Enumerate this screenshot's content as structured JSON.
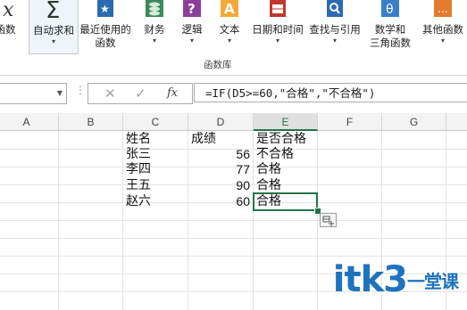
{
  "ribbon": {
    "buttons": [
      {
        "label": "函数",
        "icon": "insert-function-icon"
      },
      {
        "label": "自动求和",
        "icon": "sum-icon",
        "caret": "▾"
      },
      {
        "label": "最近使用的",
        "label2": "函数",
        "icon": "recently-used-icon",
        "caret": "▾"
      },
      {
        "label": "财务",
        "icon": "financial-icon",
        "caret": "▾"
      },
      {
        "label": "逻辑",
        "icon": "logical-icon",
        "caret": "▾"
      },
      {
        "label": "文本",
        "icon": "text-icon",
        "caret": "▾"
      },
      {
        "label": "日期和时间",
        "icon": "date-time-icon",
        "caret": "▾"
      },
      {
        "label": "查找与引用",
        "icon": "lookup-reference-icon",
        "caret": "▾"
      },
      {
        "label": "数学和",
        "label2": "三角函数",
        "icon": "math-trig-icon",
        "caret": "▾"
      },
      {
        "label": "其他函数",
        "icon": "more-functions-icon",
        "caret": "▾"
      }
    ],
    "group_label": "函数库"
  },
  "formula_bar": {
    "name_box": "",
    "cancel": "✕",
    "enter": "✓",
    "fx": "fx",
    "formula": "=IF(D5>=60,\"合格\",\"不合格\")"
  },
  "grid": {
    "columns": [
      "A",
      "B",
      "C",
      "D",
      "E",
      "F",
      "G"
    ],
    "selected_column": "E",
    "rows": [
      {
        "c": "姓名",
        "d": "成绩",
        "e": "是否合格"
      },
      {
        "c": "张三",
        "d": "56",
        "e": "不合格"
      },
      {
        "c": "李四",
        "d": "77",
        "e": "合格"
      },
      {
        "c": "王五",
        "d": "90",
        "e": "合格"
      },
      {
        "c": "赵六",
        "d": "60",
        "e": "合格"
      }
    ]
  },
  "watermark": {
    "text": "itk3",
    "suffix": "一堂课"
  },
  "colors": {
    "accent": "#217346",
    "watermark": "#1e73be"
  }
}
